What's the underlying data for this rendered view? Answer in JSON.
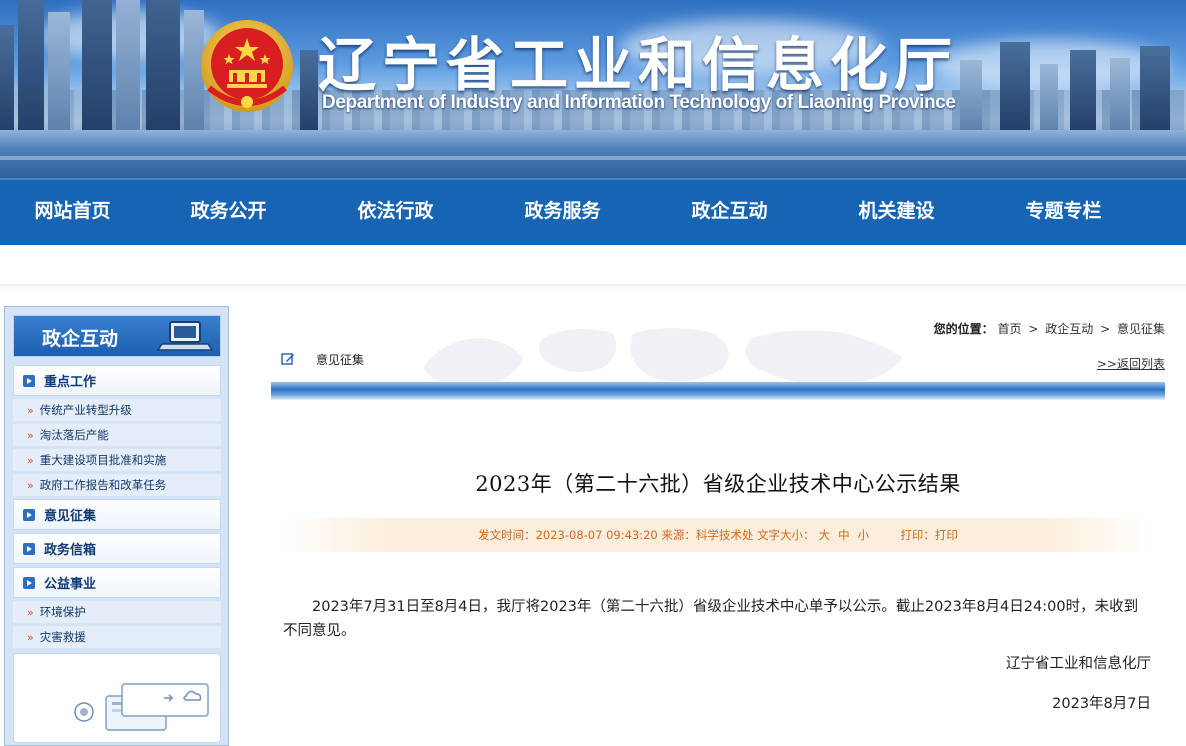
{
  "header": {
    "title_cn": "辽宁省工业和信息化厅",
    "title_en": "Department of Industry and Information Technology of Liaoning Province"
  },
  "nav": [
    "网站首页",
    "政务公开",
    "依法行政",
    "政务服务",
    "政企互动",
    "机关建设",
    "专题专栏"
  ],
  "sidebar": {
    "title": "政企互动",
    "sections": [
      {
        "label": "重点工作",
        "items": [
          "传统产业转型升级",
          "淘汰落后产能",
          "重大建设项目批准和实施",
          "政府工作报告和改革任务"
        ]
      },
      {
        "label": "意见征集",
        "items": []
      },
      {
        "label": "政务信箱",
        "items": []
      },
      {
        "label": "公益事业",
        "items": [
          "环境保护",
          "灾害救援"
        ]
      }
    ]
  },
  "breadcrumb": {
    "prefix": "您的位置：",
    "items": [
      "首页",
      "政企互动",
      "意见征集"
    ],
    "separator": ">"
  },
  "section_title": "意见征集",
  "back_link": ">>返回列表",
  "article": {
    "title": "2023年（第二十六批）省级企业技术中心公示结果",
    "meta": {
      "time_label": "发文时间：",
      "time": "2023-08-07 09:43:20",
      "source_label": "来源：",
      "source": "科学技术处",
      "font_label": "文字大小：",
      "sizes": [
        "大",
        "中",
        "小"
      ],
      "print_label": "打印：",
      "print": "打印"
    },
    "body": "2023年7月31日至8月4日，我厅将2023年（第二十六批）省级企业技术中心单予以公示。截止2023年8月4日24:00时，未收到不同意见。",
    "signature": "辽宁省工业和信息化厅",
    "date": "2023年8月7日"
  },
  "colors": {
    "nav_bg": "#1764b2",
    "sidebar_bg": "#d4e3f5",
    "meta_text": "#d2691e",
    "link": "#103a78"
  }
}
